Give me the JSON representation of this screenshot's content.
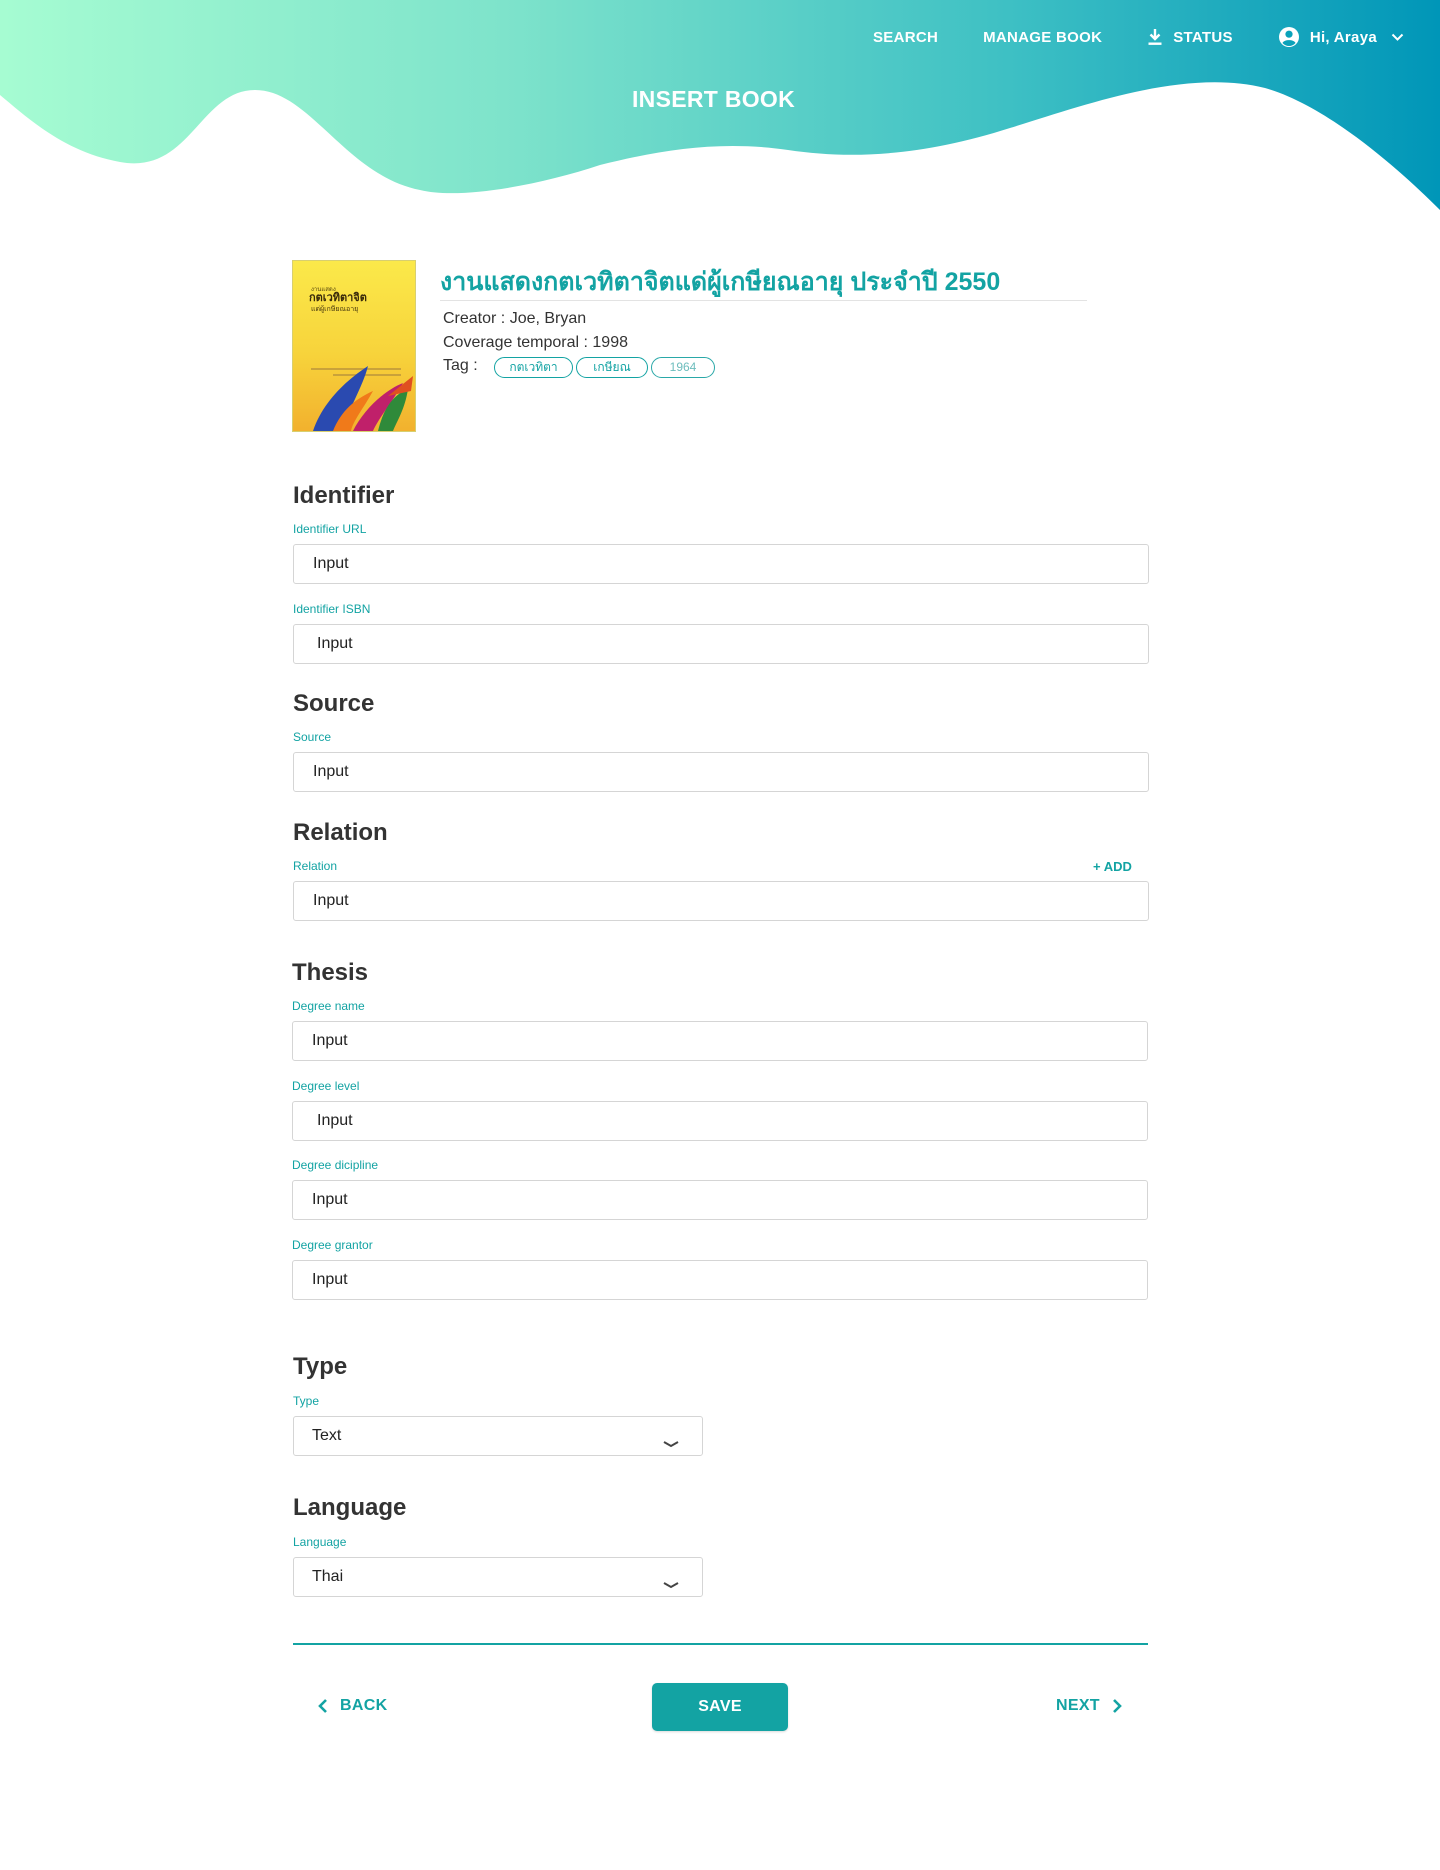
{
  "nav": {
    "search": "SEARCH",
    "manage_book": "MANAGE BOOK",
    "status": "STATUS",
    "user": "Hi, Araya"
  },
  "page_title": "INSERT BOOK",
  "book": {
    "title": "งานแสดงกตเวทิตาจิตแด่ผู้เกษียณอายุ ประจำปี 2550",
    "creator": "Creator : Joe, Bryan",
    "coverage": "Coverage temporal : 1998",
    "tag_label": "Tag :",
    "tags": [
      "กตเวทิตา",
      "เกษียณ",
      "1964"
    ],
    "cover_text": {
      "line1": "งานแสดง",
      "line2": "กตเวทิตาจิต",
      "line3": "แด่ผู้เกษียณอายุ"
    }
  },
  "sections": {
    "identifier": {
      "title": "Identifier",
      "url_label": "Identifier URL",
      "url_value": "Input",
      "isbn_label": "Identifier ISBN",
      "isbn_value": "Input"
    },
    "source": {
      "title": "Source",
      "label": "Source",
      "value": "Input"
    },
    "relation": {
      "title": "Relation",
      "label": "Relation",
      "value": "Input",
      "add": "+ ADD"
    },
    "thesis": {
      "title": "Thesis",
      "degree_name_label": "Degree name",
      "degree_name_value": "Input",
      "degree_level_label": "Degree level",
      "degree_level_value": "Input",
      "degree_discipline_label": "Degree dicipline",
      "degree_discipline_value": "Input",
      "degree_grantor_label": "Degree grantor",
      "degree_grantor_value": "Input"
    },
    "type": {
      "title": "Type",
      "label": "Type",
      "value": "Text"
    },
    "language": {
      "title": "Language",
      "label": "Language",
      "value": "Thai"
    }
  },
  "footer": {
    "back": "BACK",
    "save": "SAVE",
    "next": "NEXT"
  },
  "colors": {
    "accent": "#13a3a3",
    "gradient_start": "#a6fcd2",
    "gradient_end": "#0096b8"
  },
  "icons": [
    "download-icon",
    "account-circle-icon",
    "chevron-down-icon",
    "chevron-left-icon",
    "chevron-right-icon"
  ]
}
